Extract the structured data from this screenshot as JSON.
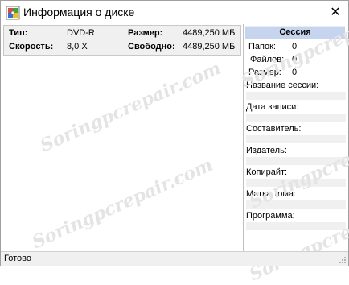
{
  "window": {
    "title": "Информация о диске",
    "close_glyph": "✕"
  },
  "disc_info": {
    "type_label": "Тип:",
    "type_value": "DVD-R",
    "speed_label": "Скорость:",
    "speed_value": "8,0 X",
    "size_label": "Размер:",
    "size_value": "4489,250 МБ",
    "free_label": "Свободно:",
    "free_value": "4489,250 МБ"
  },
  "session": {
    "header": "Сессия",
    "folders_label": "Папок:",
    "folders_value": "0",
    "files_label": "Файлов:",
    "files_value": "0",
    "size_label": "Размер:",
    "size_value": "0",
    "fields": [
      "Название сессии:",
      "Дата записи:",
      "Составитель:",
      "Издатель:",
      "Копирайт:",
      "Метка тома:",
      "Программа:"
    ]
  },
  "statusbar": {
    "text": "Готово"
  },
  "watermark": {
    "text": "Soringpcrepair.com"
  },
  "icons": {
    "app": "disc-info-icon",
    "close": "close-icon",
    "grip": "size-grip-icon"
  }
}
